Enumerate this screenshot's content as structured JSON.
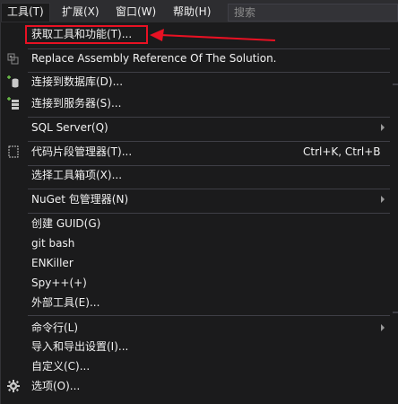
{
  "menubar": {
    "items": [
      {
        "label": "工具(T)"
      },
      {
        "label": "扩展(X)"
      },
      {
        "label": "窗口(W)"
      },
      {
        "label": "帮助(H)"
      }
    ],
    "search_placeholder": "搜索"
  },
  "menu": {
    "items": [
      {
        "label": "获取工具和功能(T)..."
      },
      {
        "label": "Replace Assembly Reference Of The Solution."
      },
      {
        "label": "连接到数据库(D)..."
      },
      {
        "label": "连接到服务器(S)..."
      },
      {
        "label": "SQL Server(Q)"
      },
      {
        "label": "代码片段管理器(T)...",
        "shortcut": "Ctrl+K, Ctrl+B"
      },
      {
        "label": "选择工具箱项(X)..."
      },
      {
        "label": "NuGet 包管理器(N)"
      },
      {
        "label": "创建 GUID(G)"
      },
      {
        "label": "git bash"
      },
      {
        "label": "ENKiller"
      },
      {
        "label": "Spy++(+)"
      },
      {
        "label": "外部工具(E)..."
      },
      {
        "label": "命令行(L)"
      },
      {
        "label": "导入和导出设置(I)..."
      },
      {
        "label": "自定义(C)..."
      },
      {
        "label": "选项(O)..."
      }
    ]
  },
  "colors": {
    "menu_bg": "#1b1b1c",
    "bar_bg": "#2d2d30",
    "text": "#f1f1f1",
    "annotation": "#e81123"
  },
  "icons": [
    "assembly-icon",
    "database-connect-icon",
    "server-connect-icon",
    "snippet-icon",
    "gear-icon"
  ]
}
